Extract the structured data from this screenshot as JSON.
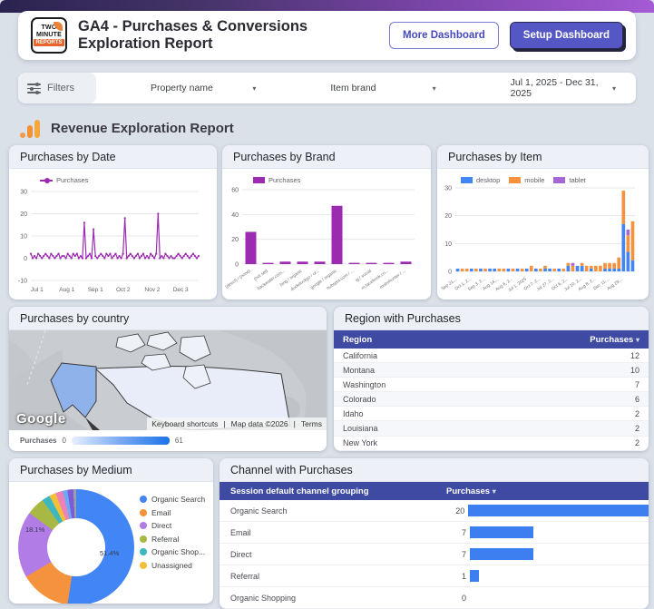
{
  "header": {
    "logo": {
      "line1": "TWO",
      "line2": "MINUTE",
      "line3": "REPORTS"
    },
    "title": "GA4 - Purchases & Conversions Exploration Report",
    "more_button": "More Dashboard",
    "setup_button": "Setup Dashboard"
  },
  "filters": {
    "label": "Filters",
    "property_filter": "Property name",
    "brand_filter": "Item brand",
    "date_range": "Jul 1, 2025 - Dec 31, 2025"
  },
  "section": {
    "title": "Revenue Exploration Report"
  },
  "chart_data": [
    {
      "id": "purchases_by_date",
      "type": "line",
      "title": "Purchases by Date",
      "legend": [
        "Purchases"
      ],
      "color": "#9c2bb2",
      "x_ticks": [
        "Jul 1",
        "Aug 1",
        "Sep 1",
        "Oct 2",
        "Nov 2",
        "Dec 3"
      ],
      "x_tick_fractions": [
        0,
        0.169,
        0.339,
        0.508,
        0.678,
        0.847
      ],
      "y_ticks": [
        30,
        20,
        10,
        0,
        -10
      ],
      "ylim": [
        -10,
        30
      ],
      "values": [
        2,
        0,
        1,
        0,
        2,
        1,
        0,
        1,
        2,
        1,
        0,
        2,
        1,
        0,
        1,
        2,
        0,
        1,
        1,
        0,
        2,
        1,
        0,
        2,
        1,
        2,
        0,
        1,
        0,
        16,
        0,
        1,
        2,
        0,
        13,
        1,
        0,
        1,
        2,
        1,
        0,
        2,
        1,
        2,
        0,
        1,
        2,
        0,
        1,
        0,
        2,
        18,
        0,
        1,
        2,
        1,
        0,
        1,
        2,
        0,
        1,
        2,
        0,
        1,
        0,
        2,
        1,
        0,
        2,
        20,
        0,
        1,
        0,
        2,
        1,
        0,
        1,
        0,
        0,
        1,
        2,
        1,
        0,
        1,
        2,
        1,
        0,
        1,
        2,
        1,
        0,
        1
      ]
    },
    {
      "id": "purchases_by_brand",
      "type": "bar",
      "title": "Purchases by Brand",
      "legend": [
        "Purchases"
      ],
      "color": "#9c2bb2",
      "categories": [
        "(direct) / (none)",
        "(not set)",
        "backwater.com...",
        "bing / organic",
        "duckduckgo / or...",
        "google / organic",
        "hubspot.com / ...",
        "ig / social",
        "m.facebook.co...",
        "mobohunter / ..."
      ],
      "values": [
        26,
        1,
        2,
        2,
        2,
        47,
        1,
        1,
        1,
        2
      ],
      "y_ticks": [
        60,
        40,
        20,
        0
      ],
      "ylim": [
        0,
        60
      ]
    },
    {
      "id": "purchases_by_item",
      "type": "stacked-bar",
      "title": "Purchases by Item",
      "series": [
        {
          "name": "desktop",
          "color": "#4285f4"
        },
        {
          "name": "mobile",
          "color": "#f5923e"
        },
        {
          "name": "tablet",
          "color": "#a566d6"
        }
      ],
      "x_ticks": [
        "Sep 21,...",
        "Oct 1, 2...",
        "Sep 3, 2...",
        "Aug 14,...",
        "Aug 6, 2...",
        "Jul 1, 2025",
        "Oct 7, 2...",
        "Jul 27, 2...",
        "Oct 6, 2...",
        "Jul 10, 2...",
        "Aug 8, 2...",
        "Dec 11,...",
        "Aug 29,..."
      ],
      "y_ticks": [
        30,
        20,
        10,
        0
      ],
      "ylim": [
        0,
        30
      ],
      "bars": [
        [
          1,
          0,
          0
        ],
        [
          0,
          1,
          0
        ],
        [
          0,
          1,
          0
        ],
        [
          1,
          0,
          0
        ],
        [
          0,
          1,
          0
        ],
        [
          1,
          0,
          0
        ],
        [
          0,
          1,
          0
        ],
        [
          1,
          0,
          0
        ],
        [
          1,
          0,
          0
        ],
        [
          0,
          1,
          0
        ],
        [
          0,
          1,
          0
        ],
        [
          1,
          0,
          0
        ],
        [
          0,
          1,
          0
        ],
        [
          1,
          0,
          0
        ],
        [
          0,
          1,
          0
        ],
        [
          1,
          0,
          0
        ],
        [
          0,
          2,
          0
        ],
        [
          1,
          0,
          0
        ],
        [
          0,
          1,
          0
        ],
        [
          1,
          1,
          0
        ],
        [
          1,
          0,
          0
        ],
        [
          0,
          1,
          0
        ],
        [
          1,
          0,
          0
        ],
        [
          0,
          1,
          0
        ],
        [
          2,
          1,
          0
        ],
        [
          0,
          2,
          1
        ],
        [
          2,
          0,
          0
        ],
        [
          2,
          1,
          0
        ],
        [
          0,
          2,
          0
        ],
        [
          1,
          1,
          0
        ],
        [
          0,
          2,
          0
        ],
        [
          0,
          2,
          0
        ],
        [
          1,
          2,
          0
        ],
        [
          1,
          2,
          0
        ],
        [
          1,
          2,
          0
        ],
        [
          1,
          4,
          0
        ],
        [
          17,
          12,
          0
        ],
        [
          7,
          6,
          2
        ],
        [
          4,
          14,
          0
        ]
      ]
    },
    {
      "id": "purchases_by_country",
      "type": "geo",
      "title": "Purchases by country",
      "google_logo": "Google",
      "attribution": [
        "Keyboard shortcuts",
        "Map data ©2026",
        "Terms"
      ],
      "legend_label": "Purchases",
      "legend_min": "0",
      "legend_max": "61"
    },
    {
      "id": "region_with_purchases",
      "type": "table",
      "title": "Region with Purchases",
      "columns": [
        "Region",
        "Purchases"
      ],
      "rows": [
        [
          "California",
          12
        ],
        [
          "Montana",
          10
        ],
        [
          "Washington",
          7
        ],
        [
          "Colorado",
          6
        ],
        [
          "Idaho",
          2
        ],
        [
          "Louisiana",
          2
        ],
        [
          "New York",
          2
        ]
      ]
    },
    {
      "id": "purchases_by_medium",
      "type": "pie",
      "title": "Purchases by Medium",
      "slices": [
        {
          "label": "Organic Search",
          "value": 51.4,
          "color": "#4285f4",
          "pct_label": "51.4%"
        },
        {
          "label": "Email",
          "value": 13.9,
          "color": "#f5923e",
          "pct_label": ""
        },
        {
          "label": "Direct",
          "value": 18.1,
          "color": "#b27ce6",
          "pct_label": "18.1%"
        },
        {
          "label": "Referral",
          "value": 5.0,
          "color": "#a8b845",
          "pct_label": ""
        },
        {
          "label": "Organic Shop...",
          "value": 2.2,
          "color": "#3cb8c0",
          "pct_label": ""
        },
        {
          "label": "Unassigned",
          "value": 1.8,
          "color": "#f2c038",
          "pct_label": ""
        },
        {
          "label": "",
          "value": 2.0,
          "color": "#ee82b6",
          "pct_label": ""
        },
        {
          "label": "",
          "value": 1.3,
          "color": "#6fa8f5",
          "pct_label": ""
        },
        {
          "label": "",
          "value": 1.6,
          "color": "#7b5bd6",
          "pct_label": ""
        },
        {
          "label": "",
          "value": 0.8,
          "color": "#9aa0a6",
          "pct_label": ""
        }
      ]
    },
    {
      "id": "channel_with_purchases",
      "type": "table-bar",
      "title": "Channel with Purchases",
      "columns": [
        "Session default channel grouping",
        "Purchases"
      ],
      "rows": [
        [
          "Organic Search",
          20
        ],
        [
          "Email",
          7
        ],
        [
          "Direct",
          7
        ],
        [
          "Referral",
          1
        ],
        [
          "Organic Shopping",
          0
        ]
      ],
      "bar_color": "#3d7ef0",
      "bar_max": 20
    }
  ]
}
